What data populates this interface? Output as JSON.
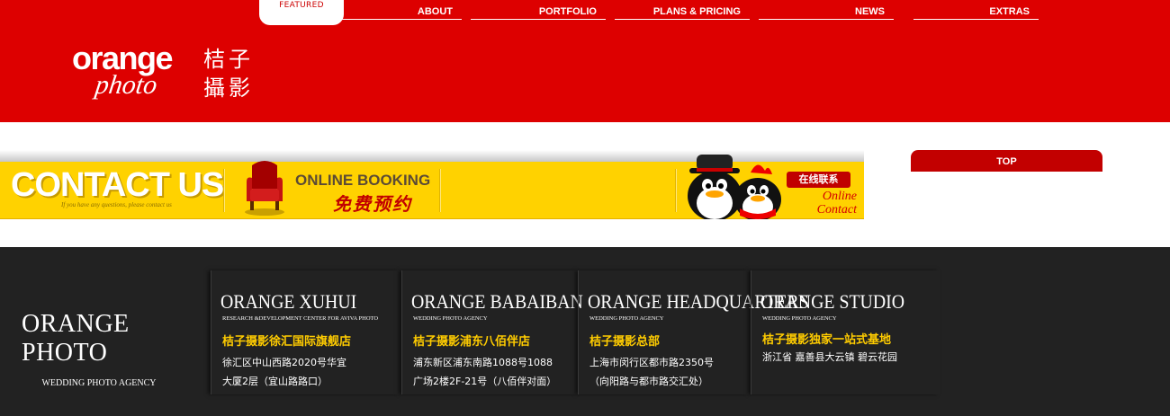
{
  "nav": {
    "featured": "FEATURED",
    "items": [
      "ABOUT",
      "PORTFOLIO",
      "PLANS & PRICING",
      "NEWS",
      "EXTRAS"
    ]
  },
  "logo": {
    "en": "orange",
    "script": "photo",
    "cn_line1": "桔子",
    "cn_line2": "攝影"
  },
  "banner": {
    "contact": "CONTACT US",
    "contact_sub": "If you have any questions, please contact us",
    "booking_en": "ONLINE BOOKING",
    "booking_cn": "免费预约",
    "online_badge": "在线联系",
    "online_line1": "Online",
    "online_line2": "Contact"
  },
  "top_button": "TOP",
  "footer": {
    "brand_name": "ORANGE PHOTO",
    "brand_sub": "WEDDING PHOTO AGENCY",
    "columns": [
      {
        "title": "ORANGE XUHUI",
        "sub": "RESEARCH &DEVELOPMENT CENTER FOR AVIVA PHOTO",
        "cn": "桔子摄影徐汇国际旗舰店",
        "addr": "徐汇区中山西路2020号华宜\n大厦2层（宜山路路口）"
      },
      {
        "title": "ORANGE BABAIBAN",
        "sub": "WEDDING PHOTO AGENCY",
        "cn": "桔子摄影浦东八佰伴店",
        "addr": "浦东新区浦东南路1088号1088\n广场2楼2F-21号（八佰伴对面）"
      },
      {
        "title": "ORANGE HEADQUARTERS",
        "sub": "WEDDING PHOTO AGENCY",
        "cn": "桔子摄影总部",
        "addr": "上海市闵行区都市路2350号\n（向阳路与都市路交汇处）"
      },
      {
        "title": "ORANGE STUDIO",
        "sub": "WEDDING PHOTO AGENCY",
        "cn": "桔子摄影独家一站式基地",
        "addr": "浙江省 嘉善县大云镇 碧云花园"
      }
    ]
  },
  "colors": {
    "brand_red": "#dd0000",
    "banner_yellow": "#ffd200",
    "footer_dark": "#222222",
    "accent_gold": "#ffcc00"
  }
}
